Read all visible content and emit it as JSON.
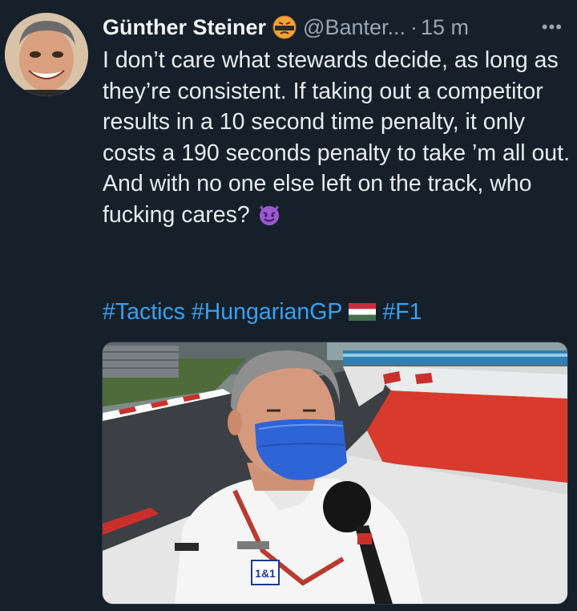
{
  "tweet": {
    "author_name": "Günther Steiner",
    "handle": "@Banter...",
    "separator": "·",
    "time": "15 m",
    "more_label": "•••",
    "name_emoji": "angry-face-emoji",
    "text": "I don’t care what stewards decide, as long as they’re consistent. If taking out a competitor results in a 10 second time penalty, it only costs a 190 seconds penalty to take ’m all out. And with no one else left on the track, who fucking cares?",
    "text_emoji": "smiling-devil-emoji",
    "hashtags": [
      "#Tactics",
      "#HungarianGP",
      "#F1"
    ],
    "flag_icon": "hungary-flag-icon",
    "media": {
      "badge_text": "1&1"
    }
  },
  "colors": {
    "background": "#15202b",
    "link": "#3aa0ee",
    "secondary_text": "#9aa6b2",
    "primary_text": "#e9ecef"
  }
}
